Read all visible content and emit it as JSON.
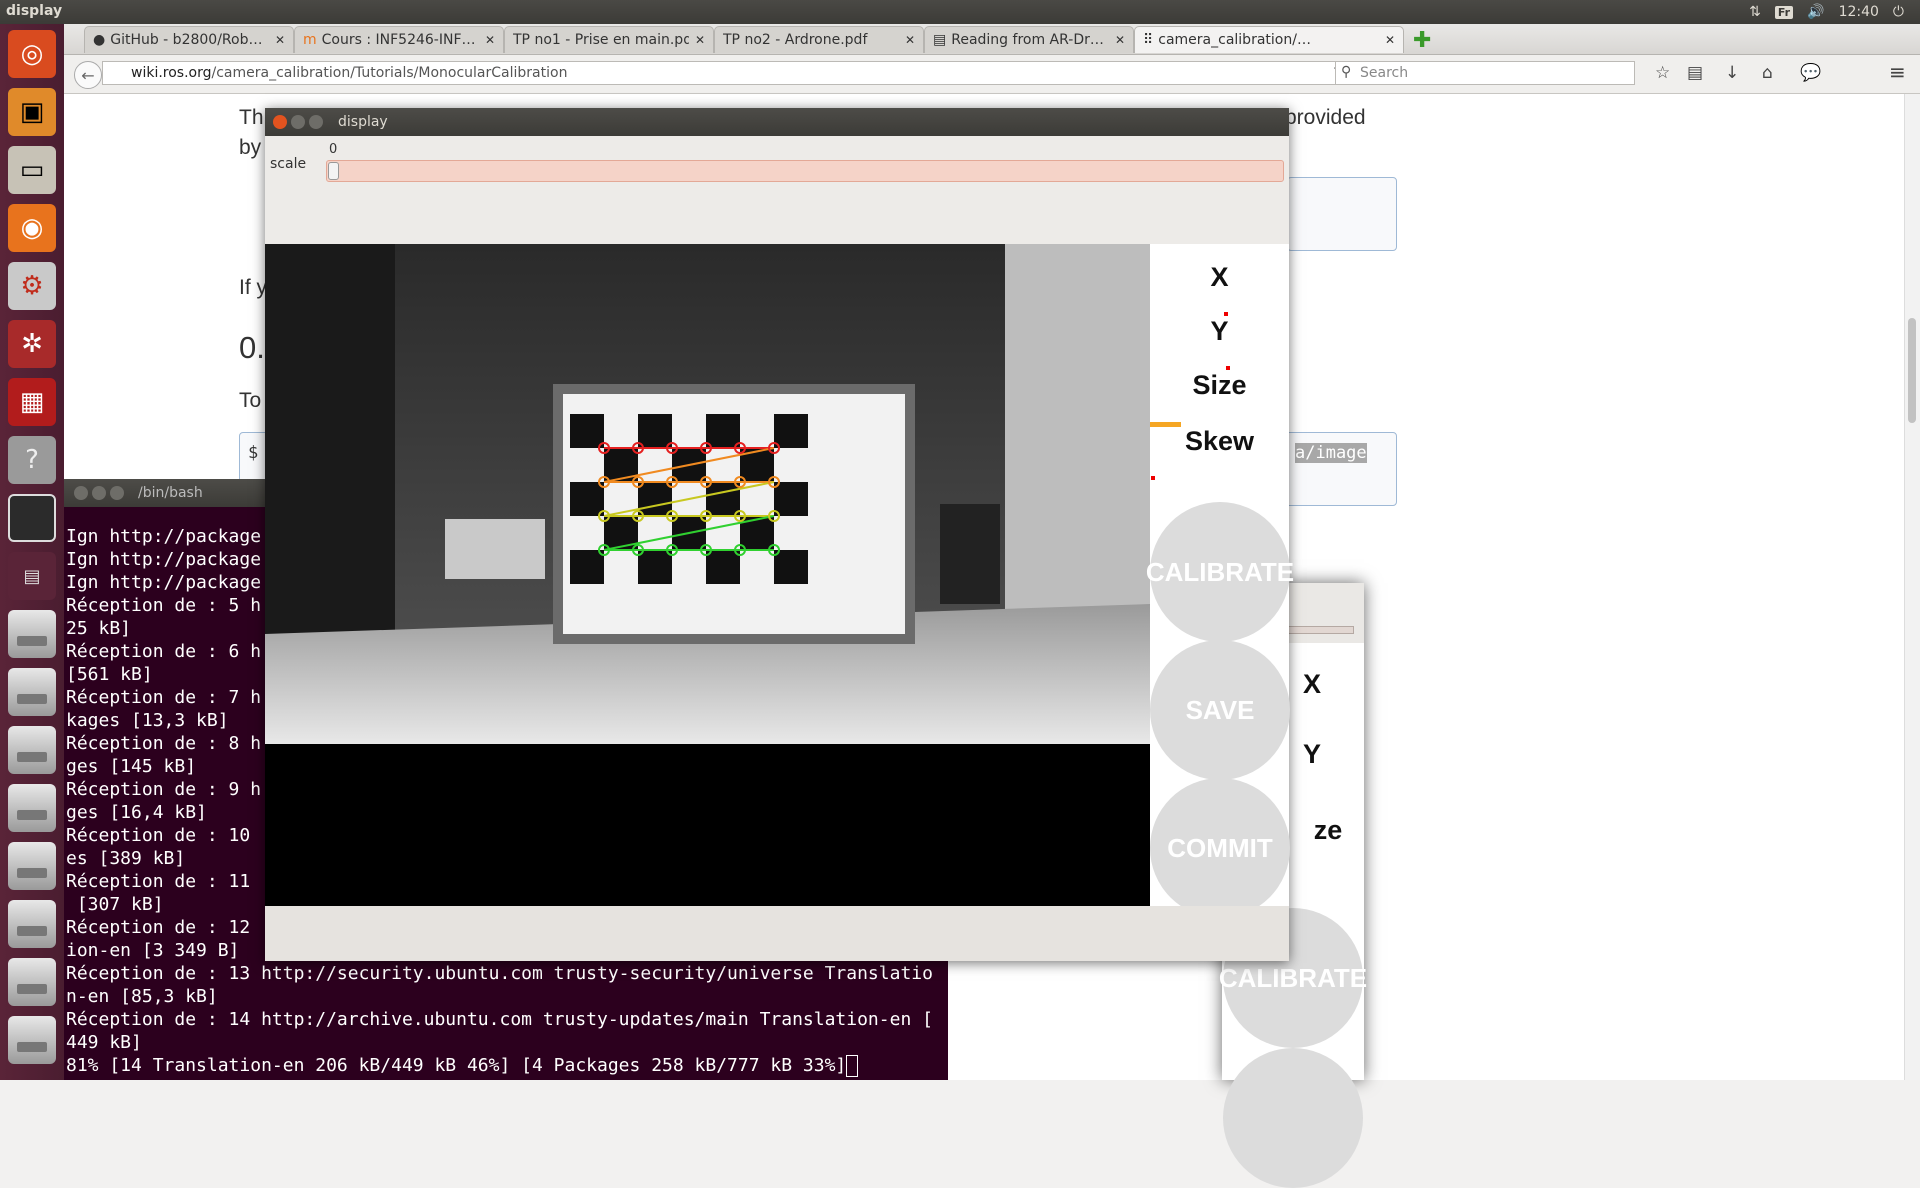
{
  "topbar": {
    "app_title": "display",
    "keyboard": "Fr",
    "clock": "12:40"
  },
  "browser": {
    "tabs": [
      {
        "label": "GitHub - b2800/Rob…",
        "icon": "github-icon"
      },
      {
        "label": "Cours : INF5246-INF…",
        "icon": "moodle-icon"
      },
      {
        "label": "TP no1 - Prise en main.pdf",
        "icon": ""
      },
      {
        "label": "TP no2 - Ardrone.pdf",
        "icon": ""
      },
      {
        "label": "Reading from AR-Dr…",
        "icon": "doc-icon"
      },
      {
        "label": "camera_calibration/…",
        "icon": "wiki-icon"
      }
    ],
    "url_host": "wiki.ros.org",
    "url_path": "/camera_calibration/Tutorials/MonocularCalibration",
    "search_placeholder": "Search"
  },
  "page": {
    "frag_th": "Th",
    "frag_by": "by",
    "frag_provided": "provided",
    "frag_ify": "If y",
    "frag_heading": "0.",
    "frag_to": "To",
    "frag_dollar": "$",
    "frag_code": "a/image"
  },
  "terminal": {
    "title": "/bin/bash",
    "lines": [
      "Ign http://package",
      "Ign http://package",
      "Ign http://package",
      "Réception de : 5 h",
      "25 kB]",
      "Réception de : 6 h",
      "[561 kB]",
      "Réception de : 7 h",
      "kages [13,3 kB]",
      "Réception de : 8 h",
      "ges [145 kB]",
      "Réception de : 9 h",
      "ges [16,4 kB]",
      "Réception de : 10",
      "es [389 kB]",
      "Réception de : 11",
      " [307 kB]",
      "Réception de : 12",
      "ion-en [3 349 B]",
      "Réception de : 13 http://security.ubuntu.com trusty-security/universe Translatio",
      "n-en [85,3 kB]",
      "Réception de : 14 http://archive.ubuntu.com trusty-updates/main Translation-en [",
      "449 kB]",
      "81% [14 Translation-en 206 kB/449 kB 46%] [4 Packages 258 kB/777 kB 33%]"
    ]
  },
  "display": {
    "title": "display",
    "scale_label": "scale",
    "scale_value": "0",
    "metrics": {
      "x": "X",
      "y": "Y",
      "size": "Size",
      "skew": "Skew"
    },
    "buttons": {
      "calibrate": "CALIBRATE",
      "save": "SAVE",
      "commit": "COMMIT"
    },
    "skew_level": 0.22
  },
  "display2": {
    "metric_x": "X",
    "metric_y": "Y",
    "metric_size": "ze",
    "calibrate": "CALIBRATE"
  },
  "colors": {
    "launcher": "#5a2438",
    "terminal_bg": "#2c001e",
    "slider": "#f5d3c8",
    "skew_bar": "#f5a623"
  }
}
